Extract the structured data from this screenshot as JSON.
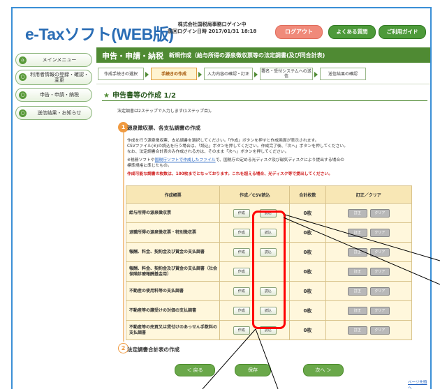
{
  "header": {
    "logo": "e-Taxソフト(WEB版)",
    "org_line1": "株式会社国税局事務口ゲイン中",
    "org_line2": "前回ログイン日時 2017/01/31 18:18",
    "logout": "ログアウト",
    "faq": "よくある質問",
    "guide": "ご利用ガイド"
  },
  "sidebar": {
    "items": [
      {
        "label": "メインメニュー"
      },
      {
        "label": "利用者情報の登録・確認・変更"
      },
      {
        "label": "申告・申請・納税"
      },
      {
        "label": "送信結果・お知らせ"
      }
    ]
  },
  "main": {
    "title": "申告・申請・納税",
    "subtitle": "新規作成（給与所得の源泉徴収票等の法定調書(及び同合計表)",
    "steps": [
      {
        "label": "作成手続きの選択"
      },
      {
        "label": "手続きの作成"
      },
      {
        "label": "入力内容の確認・訂正"
      },
      {
        "label": "署名・受付システムへの送信"
      },
      {
        "label": "送信結果の確認"
      }
    ],
    "section_title": "申告書等の作成 1/2",
    "intro": "法定調書は2ステップで入力します(1ステップ目)。",
    "step1_num": "1",
    "step1_title": "源泉徴収票、各支払調書の作成",
    "para": [
      "作成を行う源泉徴収票、支払調書を選択してください。「作成」ボタンを押すと作成画面が表示されます。",
      "CSVファイル(※)の読込を行う場合は、「読込」ボタンを押してください。作成完了後、「次へ」ボタンを押してください。",
      "なお、法定調書合計表のみ作成される方は、そのまま「次へ」ボタンを押してください。"
    ],
    "note_prefix": "※税務ソフトや",
    "note_link": "国税庁ソフトで作成したファイル",
    "note_suffix": "で、国税庁の定める光ディスク及び磁気ディスクにより提出する場合の",
    "note_line2": "標準規格に準じたもの。",
    "warning": "作成可能な調書の枚数は、100枚までとなっております。これを超える場合、光ディスク等で提出してください。",
    "step2_num": "2",
    "step2_title": "法定調書合計表の作成",
    "back": "＜ 戻る",
    "save": "保存",
    "next": "次へ ＞",
    "pagetop": "ページ先頭へ"
  },
  "table": {
    "headers": [
      "作成帳票",
      "作成／CSV読込",
      "合計枚数",
      "訂正／クリア"
    ],
    "create": "作成",
    "load": "読込",
    "fix": "訂正",
    "clear": "クリア",
    "rows": [
      {
        "name": "給与所得の源泉徴収票",
        "count": "0枚"
      },
      {
        "name": "退職所得の源泉徴収票・特別徴収票",
        "count": "0枚"
      },
      {
        "name": "報酬、料金、契約金及び賞金の支払調書",
        "count": "0枚"
      },
      {
        "name": "報酬、料金、契約金及び賞金の支払調書（社会保険診療報酬基金用）",
        "count": "0枚"
      },
      {
        "name": "不動産の使用料等の支払調書",
        "count": "0枚"
      },
      {
        "name": "不動産等の譲受けの対価の支払調書",
        "count": "0枚"
      },
      {
        "name": "不動産等の売買又は貸付けのあっせん手数料の支払調書",
        "count": "0枚"
      }
    ]
  }
}
